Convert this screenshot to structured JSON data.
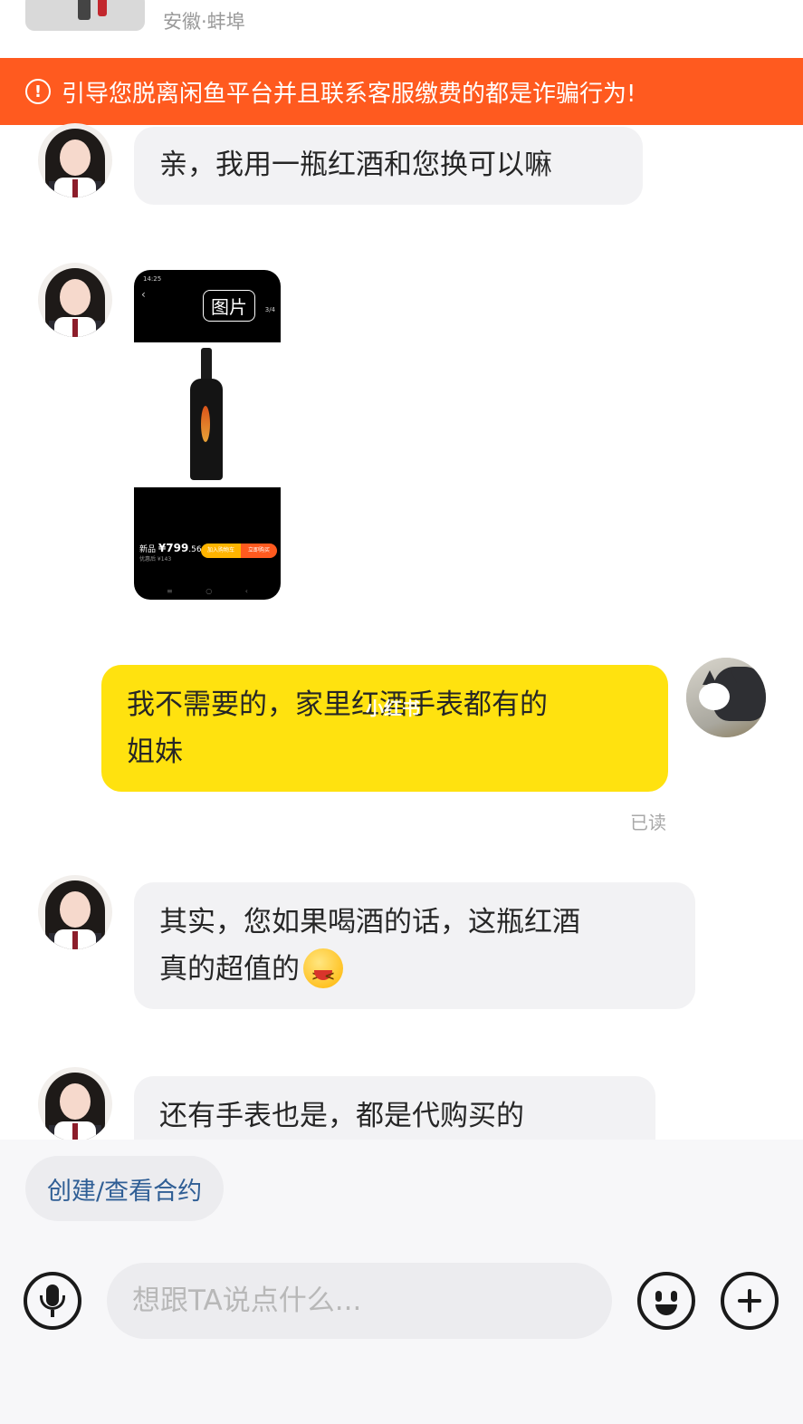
{
  "header": {
    "location": "安徽·蚌埠"
  },
  "warning": {
    "icon": "alert-circle-icon",
    "text": "引导您脱离闲鱼平台并且联系客服缴费的都是诈骗行为!"
  },
  "messages": [
    {
      "from": "other",
      "type": "text",
      "text": "亲，我用一瓶红酒和您换可以嘛"
    },
    {
      "from": "other",
      "type": "image",
      "label": "图片",
      "screenshot": {
        "status_time": "14:25",
        "page_indicator": "3/4",
        "price_prefix": "新品",
        "price": "¥799",
        "price_decimal": ".56",
        "price_sub": "优惠后 ¥143",
        "cart_button": "加入购物车",
        "buy_button": "立即购买"
      }
    },
    {
      "from": "me",
      "type": "text",
      "line1": "我不需要的，家里红酒手表都有的",
      "line2": "姐妹",
      "status": "已读"
    },
    {
      "from": "other",
      "type": "text",
      "line1": "其实，您如果喝酒的话，这瓶红酒",
      "line2": "真的超值的",
      "emoji": "squinting-laugh-emoji"
    },
    {
      "from": "other",
      "type": "text",
      "text": "还有手表也是，都是代购买的"
    }
  ],
  "watermark": "小红书",
  "contract_chip": "创建/查看合约",
  "input": {
    "placeholder": "想跟TA说点什么..."
  },
  "colors": {
    "warning_bg": "#ff5a1f",
    "my_bubble": "#ffe20f",
    "other_bubble": "#f2f2f4",
    "link_blue": "#2f5e95"
  }
}
